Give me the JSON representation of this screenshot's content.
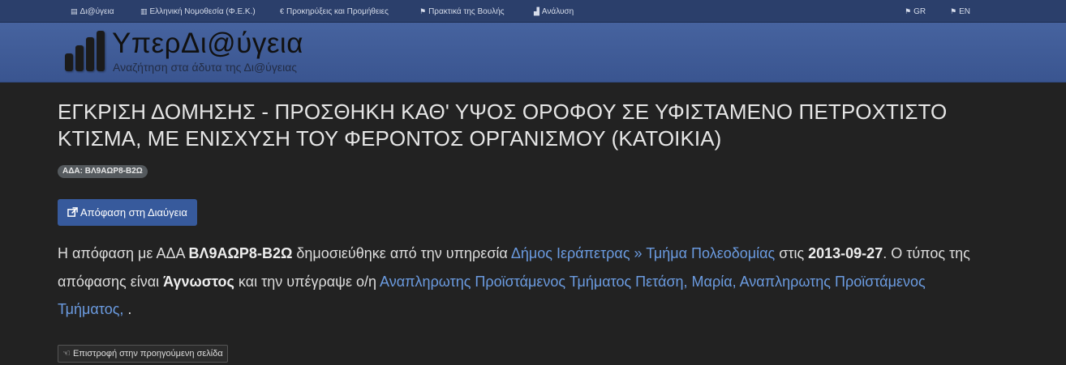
{
  "topnav": {
    "items": [
      {
        "label": "Δι@ύγεια",
        "icon": "archive-icon"
      },
      {
        "label": "Ελληνική Νομοθεσία (Φ.Ε.Κ.)",
        "icon": "book-icon"
      },
      {
        "label": "Προκηρύξεις και Προμήθειες",
        "icon": "euro-icon"
      },
      {
        "label": "Πρακτικά της Βουλής",
        "icon": "flag-icon"
      },
      {
        "label": "Ανάλυση",
        "icon": "chart-icon"
      }
    ],
    "lang_gr": "GR",
    "lang_en": "EN"
  },
  "brand": {
    "title": "ΥπερΔι@ύγεια",
    "subtitle": "Αναζήτηση στα άδυτα της Δι@ύγειας"
  },
  "decision": {
    "title": "ΕΓΚΡΙΣΗ ΔΟΜΗΣΗΣ - ΠΡΟΣΘΗΚΗ ΚΑΘ' ΥΨΟΣ ΟΡΟΦΟΥ ΣΕ ΥΦΙΣΤΑΜΕΝΟ ΠΕΤΡΟΧΤΙΣΤΟ ΚΤΙΣΜΑ, ΜΕ ΕΝΙΣΧΥΣΗ ΤΟΥ ΦΕΡΟΝΤΟΣ ΟΡΓΑΝΙΣΜΟΥ (ΚΑΤΟΙΚΙΑ)",
    "ada_badge": "ΑΔΑ: ΒΛ9ΑΩΡ8-Β2Ω",
    "open_button": "Απόφαση στη Διαύγεια"
  },
  "description": {
    "t1": "Η απόφαση με ΑΔΑ ",
    "ada": "ΒΛ9ΑΩΡ8-Β2Ω",
    "t2": " δημοσιεύθηκε από την υπηρεσία ",
    "org": "Δήμος Ιεράπετρας",
    "sep": " » ",
    "unit": "Τμήμα Πολεοδομίας",
    "t3": " στις ",
    "date": "2013-09-27",
    "t4": ". Ο τύπος της απόφασης είναι ",
    "type": "Άγνωστος",
    "t5": " και την υπέγραψε ο/η ",
    "signer": "Αναπληρωτης Προϊστάμενος Τμήματος Πετάση, Μαρία, Αναπληρωτης Προϊστάμενος Τμήματος,",
    "t6": " ."
  },
  "back_button": "Επιστροφή στην προηγούμενη σελίδα"
}
